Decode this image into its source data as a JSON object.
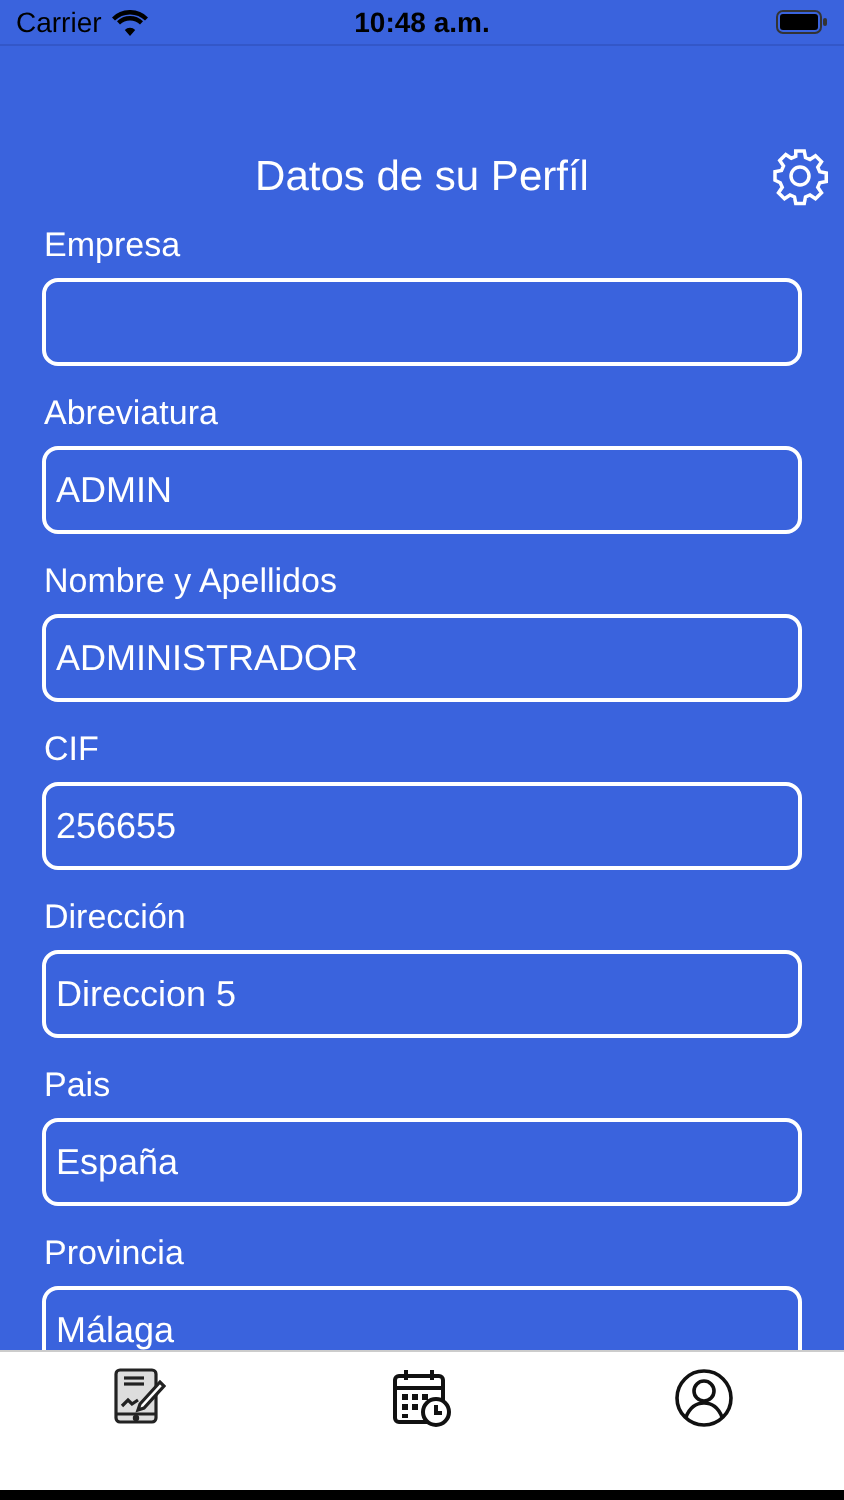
{
  "status_bar": {
    "carrier": "Carrier",
    "time": "10:48 a.m."
  },
  "header": {
    "title": "Datos de su Perfíl"
  },
  "fields": [
    {
      "label": "Empresa"
    },
    {
      "label": "Abreviatura",
      "value": "ADMIN"
    },
    {
      "label": "Nombre y Apellidos",
      "value": "ADMINISTRADOR"
    },
    {
      "label": "CIF",
      "value": "256655"
    },
    {
      "label": "Dirección",
      "value": "Direccion 5"
    },
    {
      "label": "Pais",
      "value": "España"
    },
    {
      "label": "Provincia",
      "value": "Málaga"
    }
  ],
  "tab_bar": [
    {
      "kind": "tablet"
    },
    {
      "kind": "calendar"
    },
    {
      "kind": "user"
    }
  ]
}
